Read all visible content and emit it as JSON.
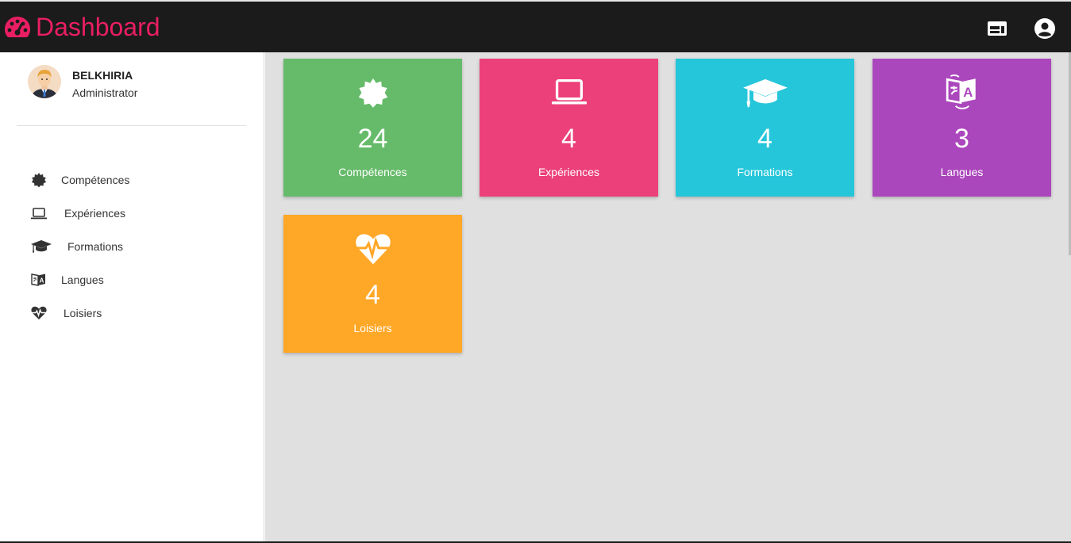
{
  "app": {
    "title": "Dashboard",
    "brand_color": "#e91e63",
    "brand_icon": "speedometer-icon"
  },
  "topbar": {
    "icons": [
      "web-layout-icon",
      "account-circle-icon"
    ]
  },
  "user": {
    "name": "BELKHIRIA",
    "role": "Administrator"
  },
  "sidebar": {
    "items": [
      {
        "label": "Compétences",
        "icon": "badge-icon"
      },
      {
        "label": "Expériences",
        "icon": "laptop-icon"
      },
      {
        "label": "Formations",
        "icon": "graduation-cap-icon"
      },
      {
        "label": "Langues",
        "icon": "translate-icon"
      },
      {
        "label": "Loisiers",
        "icon": "heartbeat-icon"
      }
    ]
  },
  "cards": [
    {
      "label": "Compétences",
      "count": "24",
      "color": "#66bb6a",
      "icon": "badge-icon"
    },
    {
      "label": "Expériences",
      "count": "4",
      "color": "#ec407a",
      "icon": "laptop-icon"
    },
    {
      "label": "Formations",
      "count": "4",
      "color": "#26c6da",
      "icon": "graduation-cap-icon"
    },
    {
      "label": "Langues",
      "count": "3",
      "color": "#ab47bc",
      "icon": "translate-icon"
    },
    {
      "label": "Loisiers",
      "count": "4",
      "color": "#ffa726",
      "icon": "heartbeat-icon"
    }
  ]
}
